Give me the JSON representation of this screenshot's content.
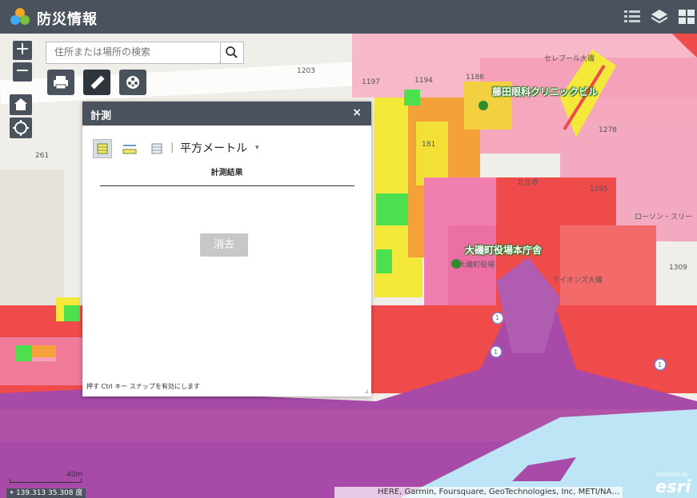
{
  "header": {
    "title": "防災情報",
    "icons": [
      "legend-list-icon",
      "layers-icon",
      "grid-apps-icon"
    ]
  },
  "map_controls": {
    "zoom_in": "+",
    "zoom_out": "−",
    "search_placeholder": "住所または場所の検索",
    "tools": [
      "printer-icon",
      "ruler-icon",
      "film-reel-icon"
    ],
    "nav": [
      "home-icon",
      "locate-icon"
    ]
  },
  "measurement_panel": {
    "title": "計測",
    "close": "×",
    "tools": [
      "area-measure-icon",
      "distance-measure-icon",
      "location-measure-icon"
    ],
    "separator": "|",
    "unit": "平方メートル",
    "unit_caret": "▾",
    "results_label": "計測結果",
    "clear_button": "消去",
    "hint": "押す Ctrl キー スナップを有効にします",
    "resize": "⠴"
  },
  "map_labels": {
    "poi_clinic": "藤田眼科クリニックビル",
    "poi_townhall": "大磯町役場本庁舎",
    "townhall_small": "大磯町役場",
    "celeb": "セレブール大磯",
    "lawson": "ローソン・スリー",
    "lions": "ライオンズ大磯",
    "numbers": [
      "1203",
      "1197",
      "1194",
      "1186",
      "1278",
      "1295",
      "1309",
      "261",
      "181"
    ],
    "route": "1",
    "ward": "北立寺"
  },
  "footer": {
    "scale": "40m",
    "coordinates": "139.313 35.308 度",
    "attribution": "HERE, Garmin, Foursquare, GeoTechnologies, Inc, METI/NA…",
    "esri_small": "POWERED BY",
    "esri": "esri"
  },
  "colors": {
    "header_bg": "#4a525d",
    "hazard_purple": "#a84aa8",
    "hazard_red": "#ef4b4b",
    "hazard_pink": "#ef8fb0",
    "hazard_orange": "#f4a13a",
    "hazard_yellow": "#f2e036",
    "hazard_green": "#4ddf4d",
    "sea": "#bde5f5"
  }
}
